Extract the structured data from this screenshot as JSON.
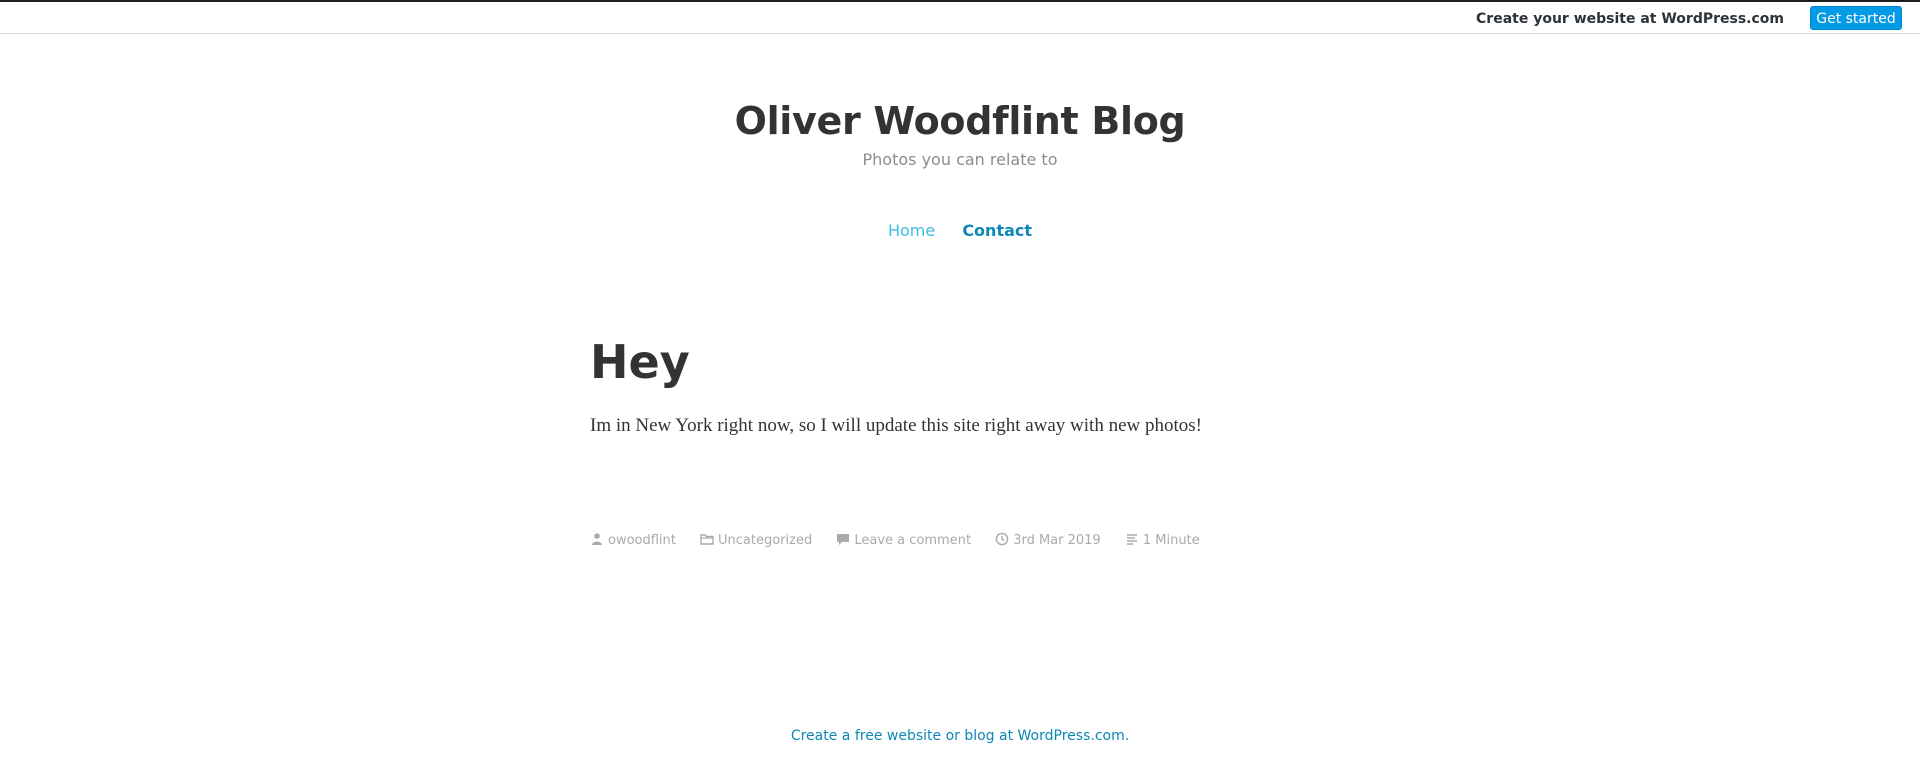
{
  "topbar": {
    "create_link": "Create your website at WordPress.com",
    "get_started": "Get started"
  },
  "site": {
    "title": "Oliver Woodflint Blog",
    "tagline": "Photos you can relate to"
  },
  "nav": {
    "items": [
      {
        "label": "Home"
      },
      {
        "label": "Contact"
      }
    ]
  },
  "post": {
    "title": "Hey",
    "body": "Im in New York right now, so I will update this site right away with new photos!",
    "meta": {
      "author": "owoodflint",
      "category": "Uncategorized",
      "comments": "Leave a comment",
      "date": "3rd Mar 2019",
      "reading_time": "1 Minute"
    }
  },
  "footer": {
    "link": "Create a free website or blog at WordPress.com."
  },
  "colors": {
    "accent": "#039be5",
    "link": "#0b88b5",
    "nav_home": "#3ebee8",
    "text": "#333333",
    "muted": "#aaaaaa"
  }
}
